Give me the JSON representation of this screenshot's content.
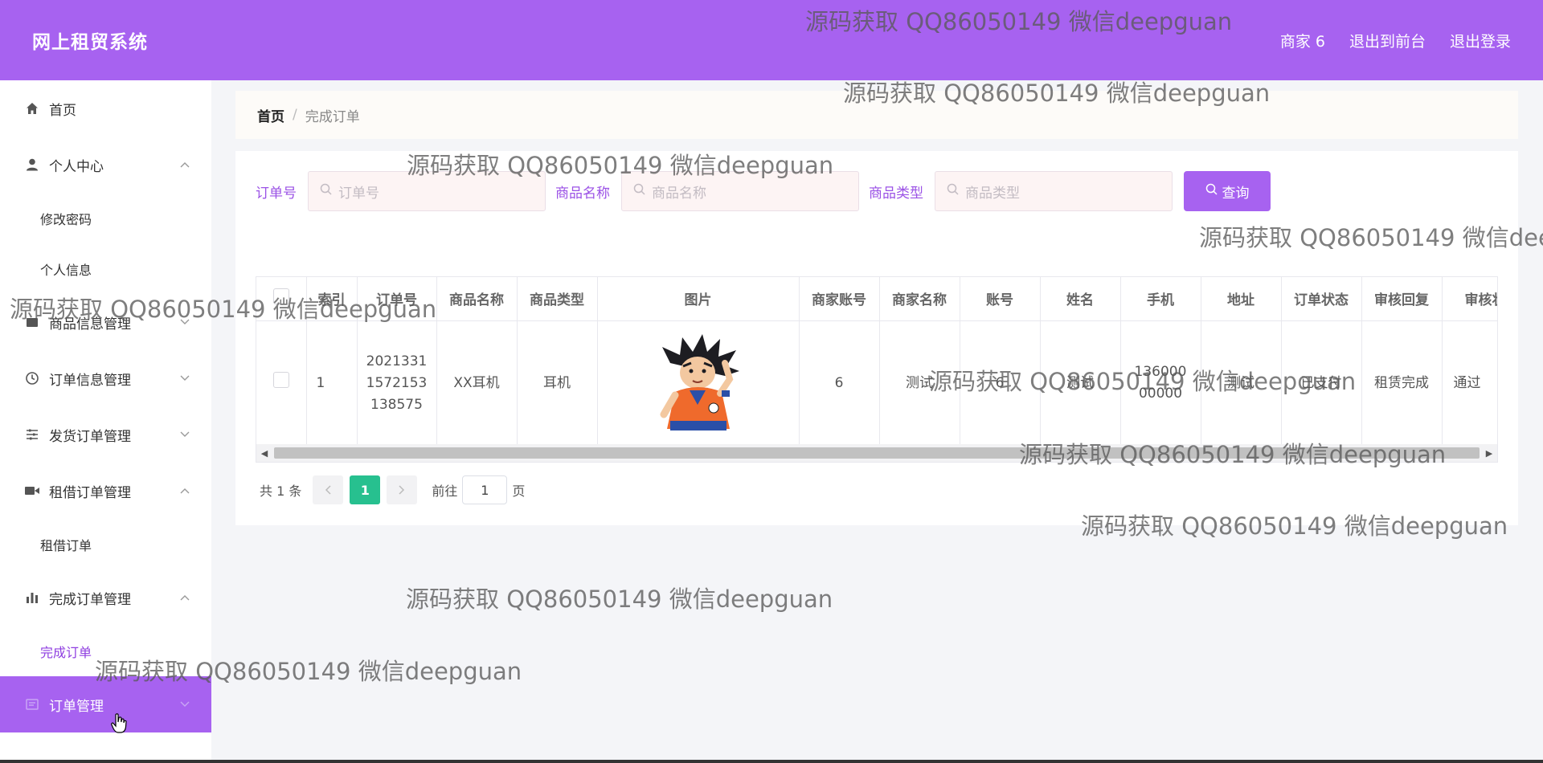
{
  "header": {
    "title": "网上租贸系统",
    "nav": [
      "商家 6",
      "退出到前台",
      "退出登录"
    ]
  },
  "sidebar": {
    "items": [
      {
        "label": "首页",
        "icon": "home-icon"
      },
      {
        "label": "个人中心",
        "icon": "user-icon",
        "expanded": true,
        "children": [
          "修改密码",
          "个人信息"
        ]
      },
      {
        "label": "商品信息管理",
        "icon": "goods-icon",
        "expanded": false
      },
      {
        "label": "订单信息管理",
        "icon": "clock-icon",
        "expanded": false
      },
      {
        "label": "发货订单管理",
        "icon": "sliders-icon",
        "expanded": false
      },
      {
        "label": "租借订单管理",
        "icon": "video-icon",
        "expanded": true,
        "children": [
          "租借订单"
        ]
      },
      {
        "label": "完成订单管理",
        "icon": "bar-chart-icon",
        "expanded": true,
        "children": [
          "完成订单"
        ]
      },
      {
        "label": "订单管理",
        "icon": "order-icon",
        "expanded": false
      }
    ],
    "active_child": "完成订单"
  },
  "breadcrumb": {
    "home": "首页",
    "separator": "/",
    "current": "完成订单"
  },
  "filters": [
    {
      "label": "订单号",
      "placeholder": "订单号"
    },
    {
      "label": "商品名称",
      "placeholder": "商品名称"
    },
    {
      "label": "商品类型",
      "placeholder": "商品类型"
    }
  ],
  "query_button": "查询",
  "table": {
    "columns": [
      "",
      "索引",
      "订单号",
      "商品名称",
      "商品类型",
      "图片",
      "商家账号",
      "商家名称",
      "账号",
      "姓名",
      "手机",
      "地址",
      "订单状态",
      "审核回复",
      "审核状态"
    ],
    "rows": [
      {
        "index": "1",
        "order_no": "20213311572153138575",
        "goods_name": "XX耳机",
        "goods_type": "耳机",
        "merchant_account": "6",
        "merchant_name": "测试",
        "account": "6",
        "name": "测试",
        "phone": "13600000000",
        "address": "测试",
        "order_status": "已支付",
        "review_reply": "租赁完成",
        "review_status": "通过"
      }
    ]
  },
  "pagination": {
    "total": "共 1 条",
    "current_page": "1",
    "goto_label": "前往",
    "goto_value": "1",
    "page_suffix": "页"
  },
  "watermark": "源码获取 QQ86050149 微信deepguan",
  "colors": {
    "primary": "#a762f0",
    "page_active": "#27c08f",
    "label": "#9b52e6"
  }
}
